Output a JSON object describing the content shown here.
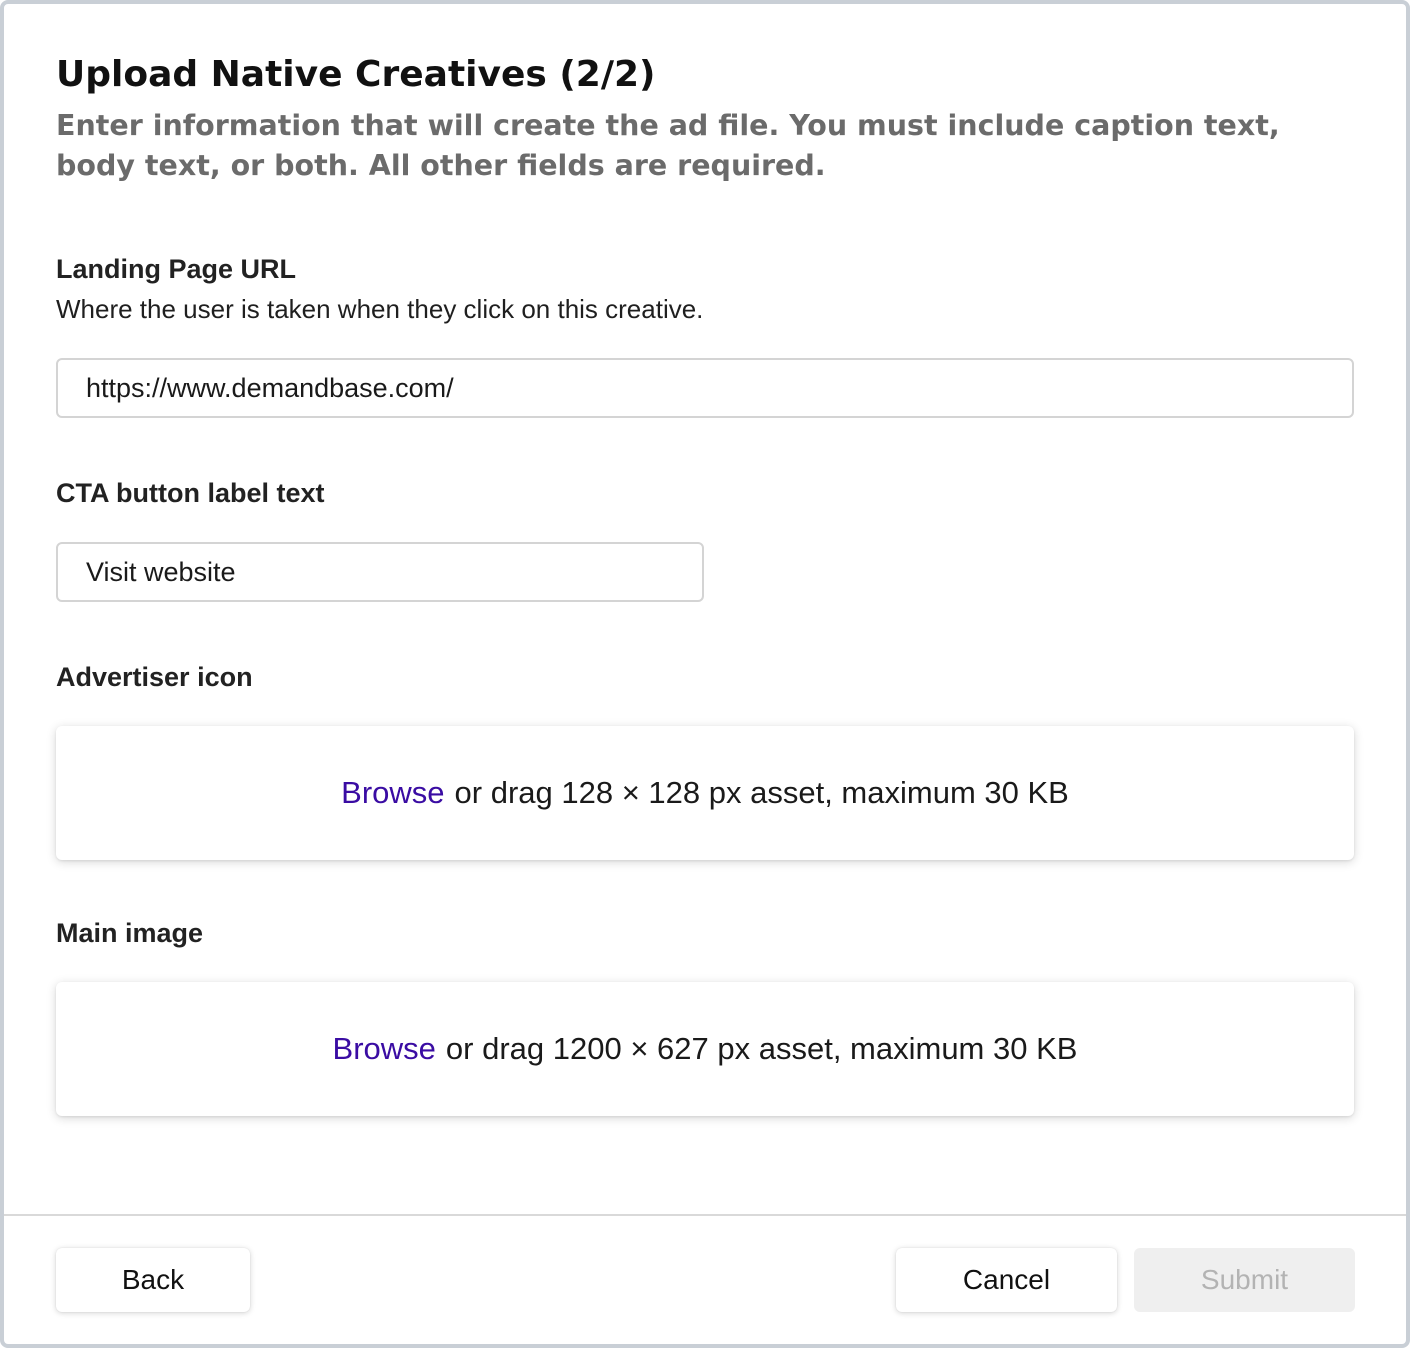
{
  "dialog": {
    "title": "Upload Native Creatives (2/2)",
    "subtitle": "Enter information that will create the ad file. You must include caption text, body text, or both. All other fields are required."
  },
  "landing_page": {
    "label": "Landing Page URL",
    "help": "Where the user is taken when they click on this creative.",
    "value": "https://www.demandbase.com/"
  },
  "cta": {
    "label": "CTA button label text",
    "value": "Visit website"
  },
  "advertiser_icon": {
    "label": "Advertiser icon",
    "browse_label": "Browse",
    "hint": "or drag 128 × 128 px asset, maximum 30 KB"
  },
  "main_image": {
    "label": "Main image",
    "browse_label": "Browse",
    "hint": "or drag 1200 × 627 px asset, maximum 30 KB"
  },
  "footer": {
    "back_label": "Back",
    "cancel_label": "Cancel",
    "submit_label": "Submit"
  },
  "colors": {
    "link": "#3a0ca3",
    "subtitle": "#6b6b6b",
    "disabled_bg": "#efefef",
    "disabled_text": "#b3b3b3"
  }
}
